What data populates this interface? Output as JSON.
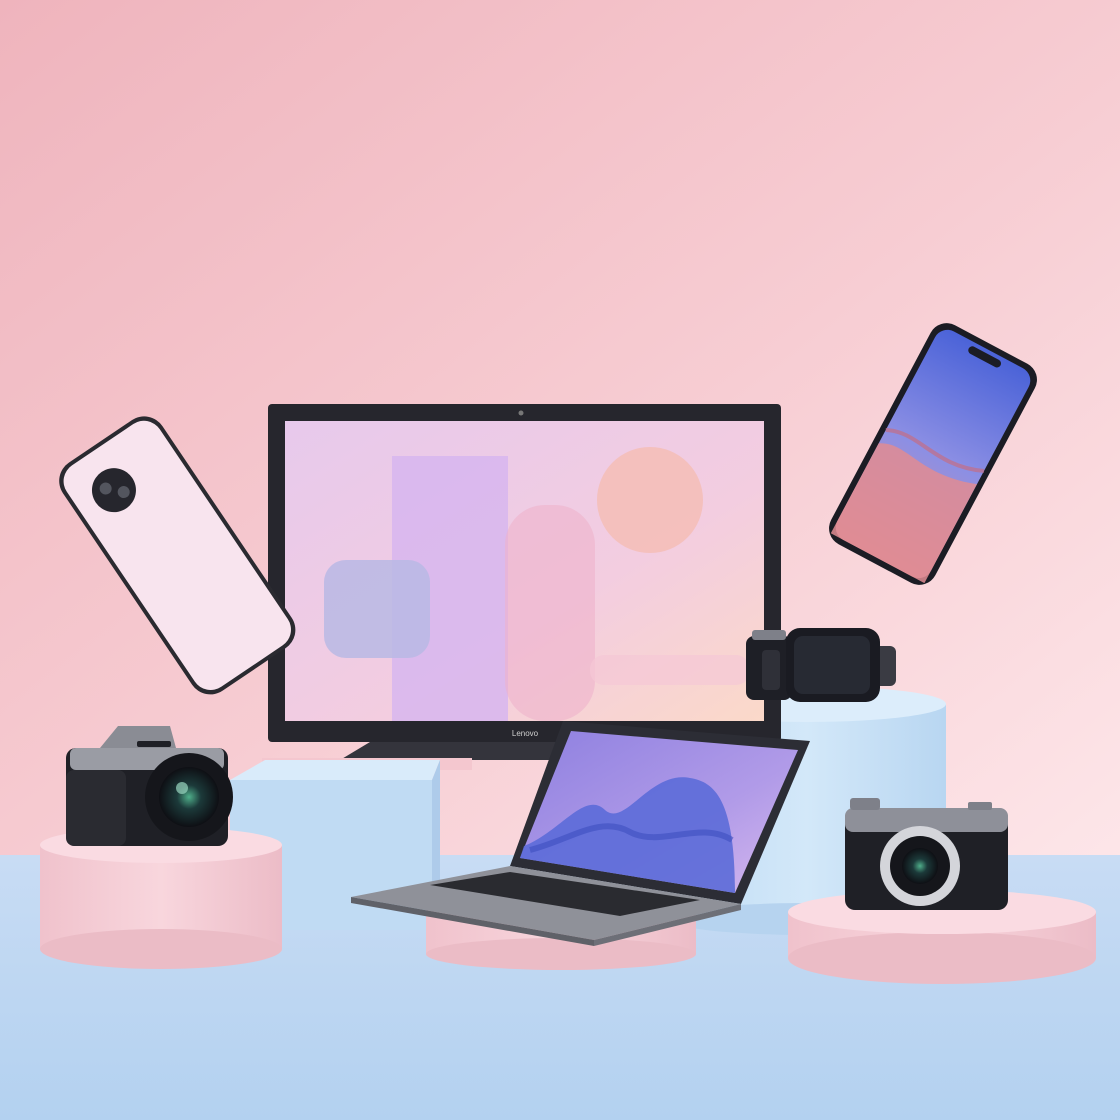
{
  "scene": {
    "colors": {
      "wall_top": "#f2bcc3",
      "wall_light": "#fde3e6",
      "floor": "#bdd7f2",
      "pink_pedestal": "#f6cdd6",
      "blue_pedestal": "#c6e1f6",
      "device_dark": "#1e1f26",
      "screen_purple": "#b9a4ee",
      "screen_blue": "#5b6fd6"
    },
    "objects": [
      {
        "id": "monitor",
        "icon": "monitor-icon",
        "logo_text": "Lenovo"
      },
      {
        "id": "laptop",
        "icon": "laptop-icon"
      },
      {
        "id": "phone-back",
        "icon": "smartphone-back-icon"
      },
      {
        "id": "phone-front",
        "icon": "smartphone-icon"
      },
      {
        "id": "smartwatch",
        "icon": "smartwatch-icon"
      },
      {
        "id": "dslr-camera",
        "icon": "camera-icon"
      },
      {
        "id": "compact-camera",
        "icon": "camera-icon"
      },
      {
        "id": "small-camera",
        "icon": "camera-icon"
      }
    ]
  }
}
